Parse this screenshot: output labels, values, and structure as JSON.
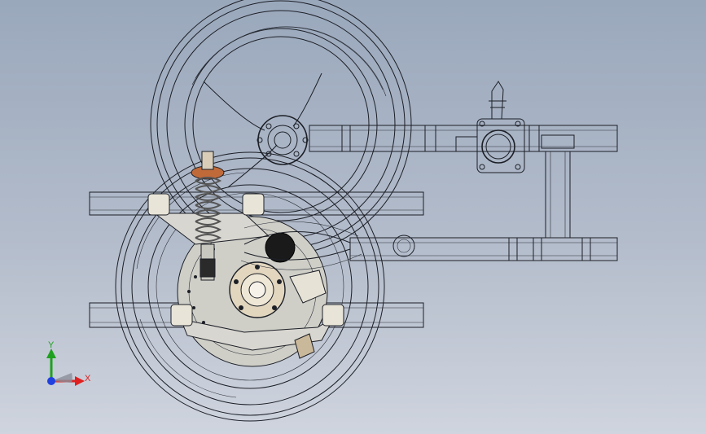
{
  "app": {
    "view": "cad-3d-viewport",
    "background_top": "#9aa8bc",
    "background_bottom": "#cfd4de"
  },
  "model": {
    "description_icon": "suspension-assembly",
    "colors": {
      "wireframe": "#1c1f26",
      "spring": "#6b6b6b",
      "spring_seat": "#c06a3a",
      "bushing": "#e8e4d8",
      "hub": "#e2d6bf",
      "brake_disc": "#cfcfc8"
    }
  },
  "triad": {
    "x_label": "X",
    "y_label": "Y",
    "x_color": "#e02020",
    "y_color": "#20a020",
    "z_color": "#2040e0"
  }
}
